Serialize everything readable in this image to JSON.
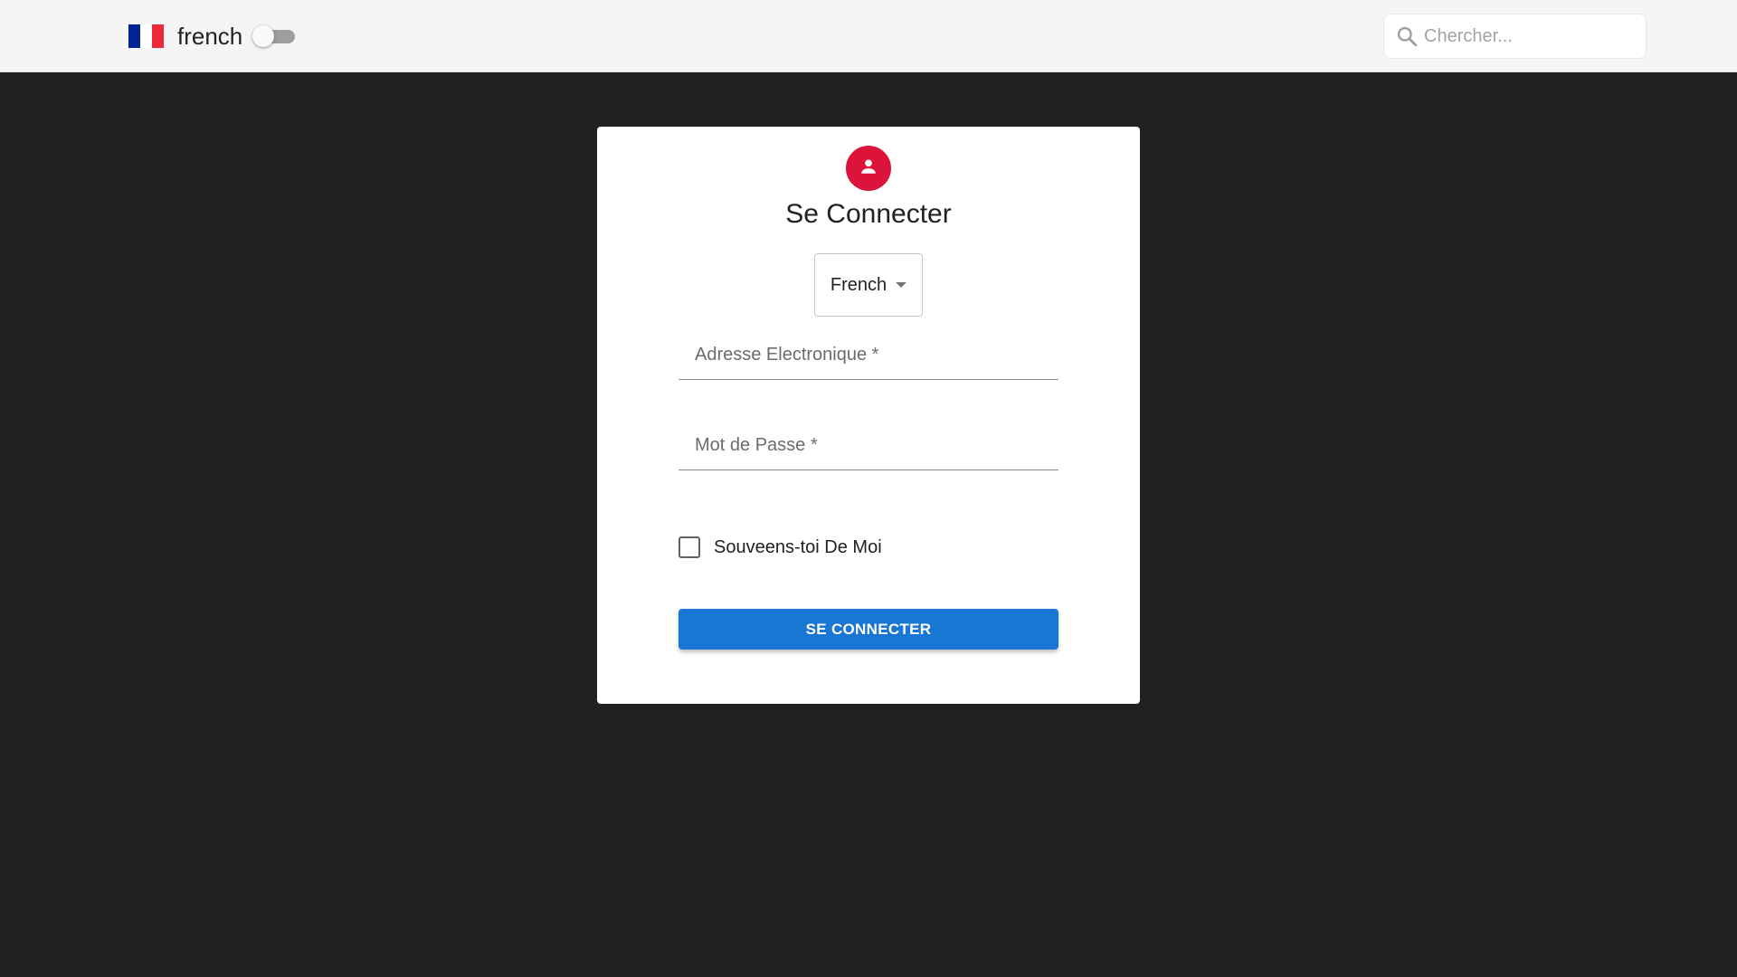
{
  "header": {
    "brand": "french",
    "flag_colors": [
      "#002395",
      "#ffffff",
      "#ed2939"
    ],
    "dark_mode_toggle": {
      "on": false
    },
    "search": {
      "placeholder": "Chercher...",
      "value": ""
    }
  },
  "login": {
    "title": "Se Connecter",
    "avatar_icon": "person-icon",
    "avatar_color": "#dc143c",
    "language_select": {
      "value": "French"
    },
    "email": {
      "placeholder": "Adresse Electronique *",
      "value": ""
    },
    "password": {
      "placeholder": "Mot de Passe *",
      "value": ""
    },
    "remember_me": {
      "label": "Souveens-toi De Moi",
      "checked": false
    },
    "submit_label": "SE CONNECTER",
    "submit_color": "#1976d2"
  },
  "colors": {
    "page_background": "#212121",
    "header_background": "#f5f5f5"
  }
}
